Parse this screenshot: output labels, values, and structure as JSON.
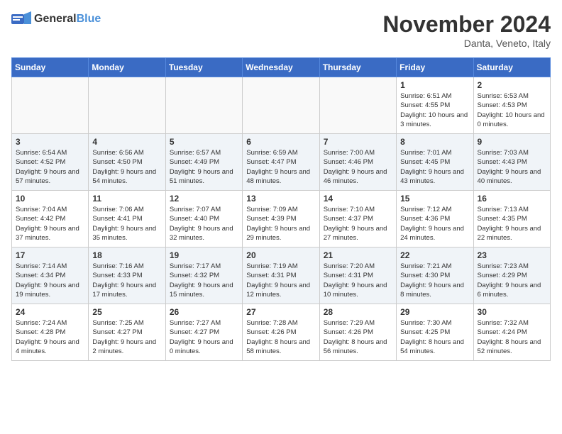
{
  "header": {
    "logo_general": "General",
    "logo_blue": "Blue",
    "month_title": "November 2024",
    "location": "Danta, Veneto, Italy"
  },
  "days_of_week": [
    "Sunday",
    "Monday",
    "Tuesday",
    "Wednesday",
    "Thursday",
    "Friday",
    "Saturday"
  ],
  "weeks": [
    [
      {
        "day": "",
        "info": "",
        "empty": true
      },
      {
        "day": "",
        "info": "",
        "empty": true
      },
      {
        "day": "",
        "info": "",
        "empty": true
      },
      {
        "day": "",
        "info": "",
        "empty": true
      },
      {
        "day": "",
        "info": "",
        "empty": true
      },
      {
        "day": "1",
        "info": "Sunrise: 6:51 AM\nSunset: 4:55 PM\nDaylight: 10 hours\nand 3 minutes."
      },
      {
        "day": "2",
        "info": "Sunrise: 6:53 AM\nSunset: 4:53 PM\nDaylight: 10 hours\nand 0 minutes."
      }
    ],
    [
      {
        "day": "3",
        "info": "Sunrise: 6:54 AM\nSunset: 4:52 PM\nDaylight: 9 hours\nand 57 minutes."
      },
      {
        "day": "4",
        "info": "Sunrise: 6:56 AM\nSunset: 4:50 PM\nDaylight: 9 hours\nand 54 minutes."
      },
      {
        "day": "5",
        "info": "Sunrise: 6:57 AM\nSunset: 4:49 PM\nDaylight: 9 hours\nand 51 minutes."
      },
      {
        "day": "6",
        "info": "Sunrise: 6:59 AM\nSunset: 4:47 PM\nDaylight: 9 hours\nand 48 minutes."
      },
      {
        "day": "7",
        "info": "Sunrise: 7:00 AM\nSunset: 4:46 PM\nDaylight: 9 hours\nand 46 minutes."
      },
      {
        "day": "8",
        "info": "Sunrise: 7:01 AM\nSunset: 4:45 PM\nDaylight: 9 hours\nand 43 minutes."
      },
      {
        "day": "9",
        "info": "Sunrise: 7:03 AM\nSunset: 4:43 PM\nDaylight: 9 hours\nand 40 minutes."
      }
    ],
    [
      {
        "day": "10",
        "info": "Sunrise: 7:04 AM\nSunset: 4:42 PM\nDaylight: 9 hours\nand 37 minutes."
      },
      {
        "day": "11",
        "info": "Sunrise: 7:06 AM\nSunset: 4:41 PM\nDaylight: 9 hours\nand 35 minutes."
      },
      {
        "day": "12",
        "info": "Sunrise: 7:07 AM\nSunset: 4:40 PM\nDaylight: 9 hours\nand 32 minutes."
      },
      {
        "day": "13",
        "info": "Sunrise: 7:09 AM\nSunset: 4:39 PM\nDaylight: 9 hours\nand 29 minutes."
      },
      {
        "day": "14",
        "info": "Sunrise: 7:10 AM\nSunset: 4:37 PM\nDaylight: 9 hours\nand 27 minutes."
      },
      {
        "day": "15",
        "info": "Sunrise: 7:12 AM\nSunset: 4:36 PM\nDaylight: 9 hours\nand 24 minutes."
      },
      {
        "day": "16",
        "info": "Sunrise: 7:13 AM\nSunset: 4:35 PM\nDaylight: 9 hours\nand 22 minutes."
      }
    ],
    [
      {
        "day": "17",
        "info": "Sunrise: 7:14 AM\nSunset: 4:34 PM\nDaylight: 9 hours\nand 19 minutes."
      },
      {
        "day": "18",
        "info": "Sunrise: 7:16 AM\nSunset: 4:33 PM\nDaylight: 9 hours\nand 17 minutes."
      },
      {
        "day": "19",
        "info": "Sunrise: 7:17 AM\nSunset: 4:32 PM\nDaylight: 9 hours\nand 15 minutes."
      },
      {
        "day": "20",
        "info": "Sunrise: 7:19 AM\nSunset: 4:31 PM\nDaylight: 9 hours\nand 12 minutes."
      },
      {
        "day": "21",
        "info": "Sunrise: 7:20 AM\nSunset: 4:31 PM\nDaylight: 9 hours\nand 10 minutes."
      },
      {
        "day": "22",
        "info": "Sunrise: 7:21 AM\nSunset: 4:30 PM\nDaylight: 9 hours\nand 8 minutes."
      },
      {
        "day": "23",
        "info": "Sunrise: 7:23 AM\nSunset: 4:29 PM\nDaylight: 9 hours\nand 6 minutes."
      }
    ],
    [
      {
        "day": "24",
        "info": "Sunrise: 7:24 AM\nSunset: 4:28 PM\nDaylight: 9 hours\nand 4 minutes."
      },
      {
        "day": "25",
        "info": "Sunrise: 7:25 AM\nSunset: 4:27 PM\nDaylight: 9 hours\nand 2 minutes."
      },
      {
        "day": "26",
        "info": "Sunrise: 7:27 AM\nSunset: 4:27 PM\nDaylight: 9 hours\nand 0 minutes."
      },
      {
        "day": "27",
        "info": "Sunrise: 7:28 AM\nSunset: 4:26 PM\nDaylight: 8 hours\nand 58 minutes."
      },
      {
        "day": "28",
        "info": "Sunrise: 7:29 AM\nSunset: 4:26 PM\nDaylight: 8 hours\nand 56 minutes."
      },
      {
        "day": "29",
        "info": "Sunrise: 7:30 AM\nSunset: 4:25 PM\nDaylight: 8 hours\nand 54 minutes."
      },
      {
        "day": "30",
        "info": "Sunrise: 7:32 AM\nSunset: 4:24 PM\nDaylight: 8 hours\nand 52 minutes."
      }
    ]
  ]
}
